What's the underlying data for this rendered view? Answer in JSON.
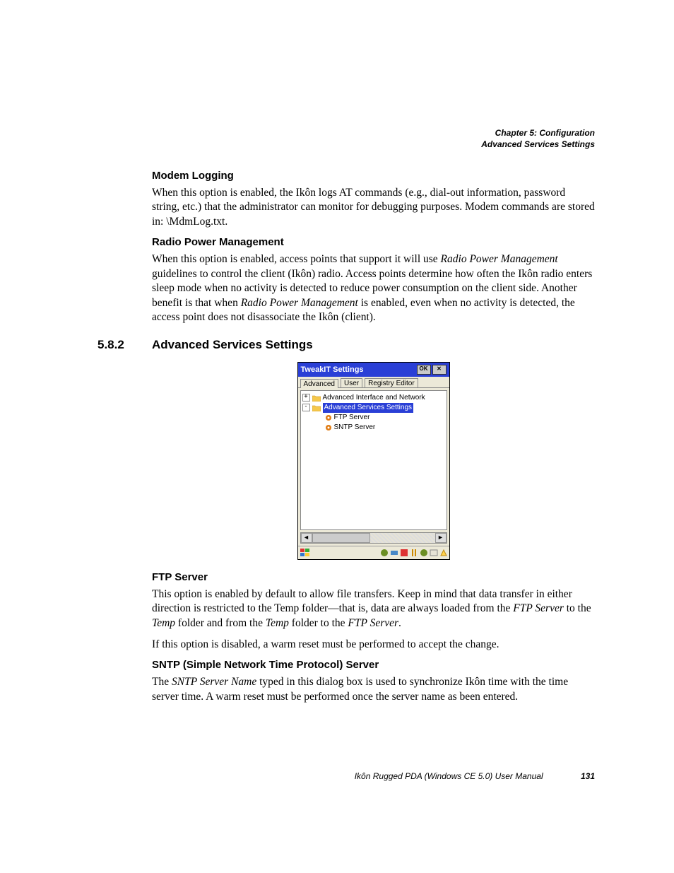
{
  "header": {
    "chapter": "Chapter 5:  Configuration",
    "section": "Advanced Services Settings"
  },
  "h_modem": "Modem Logging",
  "p_modem": "When this option is enabled, the Ikôn logs AT commands (e.g., dial-out information, password string, etc.) that the administrator can monitor for debugging purposes. Modem commands are stored in: \\MdmLog.txt.",
  "h_radio": "Radio Power Management",
  "p_radio_1a": "When this option is enabled, access points that support it will use ",
  "p_radio_1b_i": "Radio Power Management",
  "p_radio_1c": " guidelines to control the client (Ikôn) radio. Access points determine how often the Ikôn radio enters sleep mode when no activity is detected to reduce power consumption on the client side. Another benefit is that when ",
  "p_radio_1d_i": "Radio Power Management",
  "p_radio_1e": " is enabled, even when no activity is detected, the access point does not disassociate the Ikôn (client).",
  "sec_num": "5.8.2",
  "sec_title": "Advanced Services Settings",
  "win": {
    "title": "TweakIT Settings",
    "ok": "OK",
    "close": "✕",
    "tabs": {
      "t1": "Advanced",
      "t2": "User",
      "t3": "Registry Editor"
    },
    "tree": {
      "n1": "Advanced Interface and Network",
      "n2": "Advanced Services Settings",
      "c1": "FTP Server",
      "c2": "SNTP Server"
    },
    "scroll": {
      "left": "◄",
      "right": "►"
    }
  },
  "h_ftp": "FTP Server",
  "p_ftp_1a": "This option is enabled by default to allow file transfers. Keep in mind that data transfer in either direction is restricted to the Temp folder—that is, data are always loaded from the ",
  "p_ftp_1b_i": "FTP Server",
  "p_ftp_1c": " to the ",
  "p_ftp_1d_i": "Temp",
  "p_ftp_1e": " folder and from the ",
  "p_ftp_1f_i": "Temp",
  "p_ftp_1g": " folder to the ",
  "p_ftp_1h_i": "FTP Server",
  "p_ftp_1i": ".",
  "p_ftp_2": "If this option is disabled, a warm reset must be performed to accept the change.",
  "h_sntp": "SNTP (Simple Network Time Protocol) Server",
  "p_sntp_a": "The ",
  "p_sntp_b_i": "SNTP Server Name",
  "p_sntp_c": " typed in this dialog box is used to synchronize Ikôn time with the time server time. A warm reset must be performed once the server name as been entered.",
  "footer": {
    "title": "Ikôn Rugged PDA (Windows CE 5.0) User Manual",
    "page": "131"
  }
}
